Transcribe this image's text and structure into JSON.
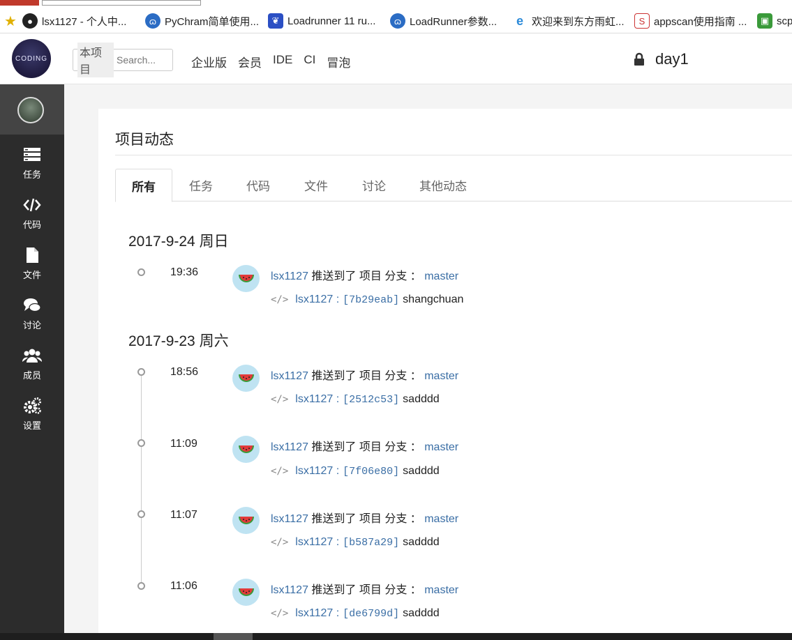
{
  "bookmarks": [
    {
      "label": "lsx1127 - 个人中...",
      "icon": "penguin-icon"
    },
    {
      "label": "PyChram简单使用...",
      "icon": "ring-icon"
    },
    {
      "label": "Loadrunner 11 ru...",
      "icon": "paw-icon"
    },
    {
      "label": "LoadRunner参数...",
      "icon": "ring-icon"
    },
    {
      "label": "欢迎来到东方雨虹...",
      "icon": "ie-icon"
    },
    {
      "label": "appscan使用指南 ...",
      "icon": "sogou-icon"
    },
    {
      "label": "scp",
      "icon": "green-box-icon"
    }
  ],
  "header": {
    "logo_text": "CODING",
    "search": {
      "scope": "本项目",
      "placeholder": "Search..."
    },
    "nav": [
      "企业版",
      "会员",
      "IDE",
      "CI",
      "冒泡"
    ],
    "project_name": "day1"
  },
  "sidebar": {
    "items": [
      {
        "label": "任务",
        "icon": "tasks-icon"
      },
      {
        "label": "代码",
        "icon": "code-icon"
      },
      {
        "label": "文件",
        "icon": "file-icon"
      },
      {
        "label": "讨论",
        "icon": "chat-icon"
      },
      {
        "label": "成员",
        "icon": "members-icon"
      },
      {
        "label": "设置",
        "icon": "settings-icon"
      }
    ]
  },
  "main": {
    "title": "项目动态",
    "tabs": [
      "所有",
      "任务",
      "代码",
      "文件",
      "讨论",
      "其他动态"
    ],
    "active_tab": "所有",
    "days": [
      {
        "date": "2017-9-24 周日",
        "events": [
          {
            "time": "19:36",
            "user": "lsx1127",
            "action": "推送到了 项目 分支 ：",
            "branch": "master",
            "commit_user": "lsx1127 :",
            "hash": "[7b29eab]",
            "message": "shangchuan"
          }
        ]
      },
      {
        "date": "2017-9-23 周六",
        "events": [
          {
            "time": "18:56",
            "user": "lsx1127",
            "action": "推送到了 项目 分支 ：",
            "branch": "master",
            "commit_user": "lsx1127 :",
            "hash": "[2512c53]",
            "message": "sadddd"
          },
          {
            "time": "11:09",
            "user": "lsx1127",
            "action": "推送到了 项目 分支 ：",
            "branch": "master",
            "commit_user": "lsx1127 :",
            "hash": "[7f06e80]",
            "message": "sadddd"
          },
          {
            "time": "11:07",
            "user": "lsx1127",
            "action": "推送到了 项目 分支 ：",
            "branch": "master",
            "commit_user": "lsx1127 :",
            "hash": "[b587a29]",
            "message": "sadddd"
          },
          {
            "time": "11:06",
            "user": "lsx1127",
            "action": "推送到了 项目 分支 ：",
            "branch": "master",
            "commit_user": "lsx1127 :",
            "hash": "[de6799d]",
            "message": "sadddd"
          }
        ]
      }
    ]
  },
  "colors": {
    "link": "#3a6ea5",
    "sidebar_bg": "#2c2c2c",
    "avatar_bg": "#bfe3f2"
  }
}
